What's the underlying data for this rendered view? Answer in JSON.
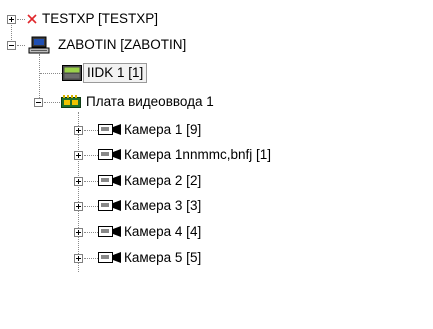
{
  "tree": {
    "nodes": [
      {
        "label": "TESTXP [TESTXP]",
        "icon": "red-x-icon"
      },
      {
        "label": "ZABOTIN [ZABOTIN]",
        "icon": "computer-icon"
      },
      {
        "label": "IIDK 1 [1]",
        "icon": "iidk-module-icon"
      },
      {
        "label": "Плата видеоввода 1",
        "icon": "video-capture-board-icon"
      },
      {
        "label": "Камера 1 [9]",
        "icon": "camera-icon"
      },
      {
        "label": "Камера 1nnmmc,bnfj [1]",
        "icon": "camera-icon"
      },
      {
        "label": "Камера 2 [2]",
        "icon": "camera-icon"
      },
      {
        "label": "Камера 3 [3]",
        "icon": "camera-icon"
      },
      {
        "label": "Камера 4 [4]",
        "icon": "camera-icon"
      },
      {
        "label": "Камера 5 [5]",
        "icon": "camera-icon"
      }
    ]
  }
}
